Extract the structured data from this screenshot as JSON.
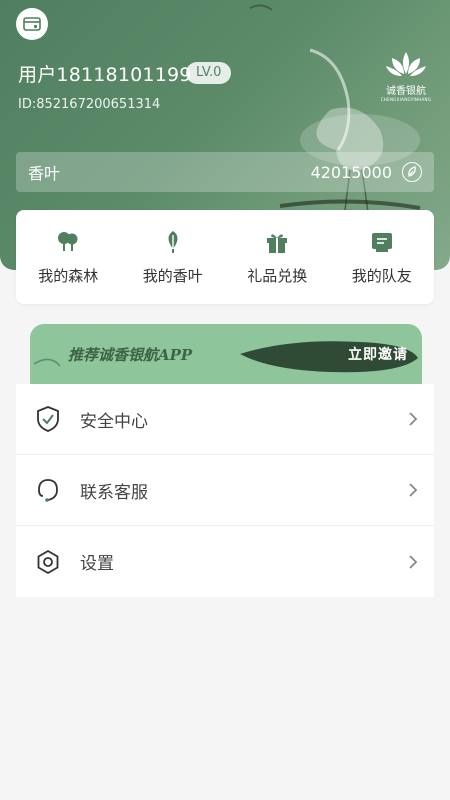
{
  "colors": {
    "brand_green": "#5b8b69",
    "icon_green": "#4f7f5f",
    "banner_green": "#8fc59b"
  },
  "header": {
    "card_icon": "card-icon",
    "username": "用户18118101199",
    "level": "LV.0",
    "user_id": "ID:852167200651314",
    "brand_name": "诚香银航",
    "brand_sub": "CHENGXIANGYINHANG"
  },
  "points": {
    "label": "香叶",
    "value": "42015000",
    "icon": "leaf-icon"
  },
  "quick_actions": [
    {
      "label": "我的森林",
      "icon": "forest-icon"
    },
    {
      "label": "我的香叶",
      "icon": "leaf-icon"
    },
    {
      "label": "礼品兑换",
      "icon": "gift-icon"
    },
    {
      "label": "我的队友",
      "icon": "team-icon"
    }
  ],
  "invite_banner": {
    "text": "推荐诚香银航APP",
    "button": "立即邀请"
  },
  "menu": [
    {
      "label": "安全中心",
      "icon": "shield-icon"
    },
    {
      "label": "联系客服",
      "icon": "headset-icon"
    },
    {
      "label": "设置",
      "icon": "settings-icon"
    }
  ]
}
